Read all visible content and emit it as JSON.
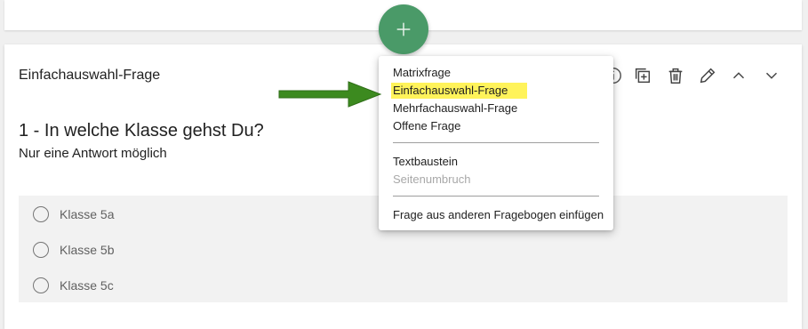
{
  "question_card": {
    "type_label": "Einfachauswahl-Frage",
    "title": "1 - In welche Klasse gehst Du?",
    "subtitle": "Nur eine Antwort möglich",
    "options": [
      "Klasse 5a",
      "Klasse 5b",
      "Klasse 5c"
    ]
  },
  "toolbar": {
    "icons": [
      "info-icon",
      "duplicate-icon",
      "trash-icon",
      "edit-icon",
      "chevron-up-icon",
      "chevron-down-icon"
    ]
  },
  "fab": {
    "icon": "plus-icon"
  },
  "menu": {
    "items": [
      {
        "label": "Matrixfrage"
      },
      {
        "label": "Einfachauswahl-Frage",
        "highlighted": true
      },
      {
        "label": "Mehrfachauswahl-Frage"
      },
      {
        "label": "Offene Frage"
      },
      {
        "label": "Textbaustein"
      },
      {
        "label": "Seitenumbruch",
        "disabled": true
      },
      {
        "label": "Frage aus anderen Fragebogen einfügen"
      }
    ]
  },
  "colors": {
    "fab": "#4a9a68",
    "highlight": "#fff35a",
    "arrow": "#3c8a1f",
    "answer_bg": "#f2f2f2"
  }
}
